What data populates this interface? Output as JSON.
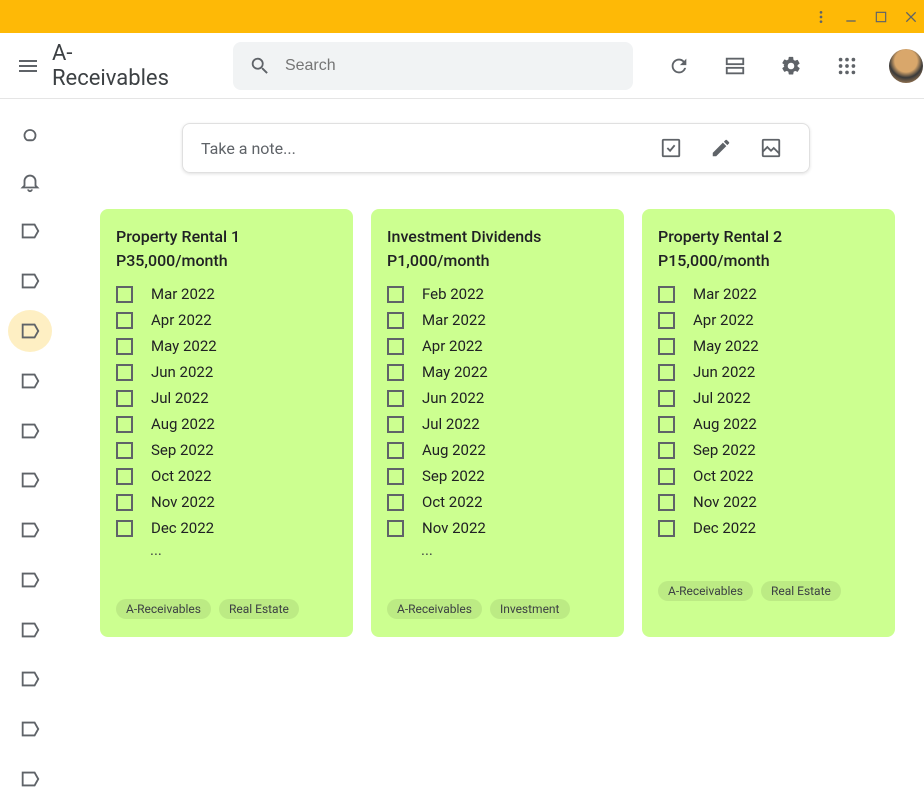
{
  "app": {
    "title": "A-Receivables"
  },
  "search": {
    "placeholder": "Search"
  },
  "take_note": {
    "placeholder": "Take a note..."
  },
  "notes": [
    {
      "title": "Property Rental 1 P35,000/month",
      "items": [
        "Mar 2022",
        "Apr 2022",
        "May 2022",
        "Jun 2022",
        "Jul 2022",
        "Aug 2022",
        "Sep 2022",
        "Oct 2022",
        "Nov 2022",
        "Dec 2022"
      ],
      "more": "...",
      "tags": [
        "A-Receivables",
        "Real Estate"
      ]
    },
    {
      "title": "Investment Dividends P1,000/month",
      "items": [
        "Feb 2022",
        "Mar 2022",
        "Apr 2022",
        "May 2022",
        "Jun 2022",
        "Jul 2022",
        "Aug 2022",
        "Sep 2022",
        "Oct 2022",
        "Nov 2022"
      ],
      "more": "...",
      "tags": [
        "A-Receivables",
        "Investment"
      ]
    },
    {
      "title": "Property Rental 2 P15,000/month",
      "items": [
        "Mar 2022",
        "Apr 2022",
        "May 2022",
        "Jun 2022",
        "Jul 2022",
        "Aug 2022",
        "Sep 2022",
        "Oct 2022",
        "Nov 2022",
        "Dec 2022"
      ],
      "more": "",
      "tags": [
        "A-Receivables",
        "Real Estate"
      ]
    }
  ],
  "sidebar": {
    "items": [
      "notes",
      "reminders",
      "label-1",
      "label-2",
      "label-3",
      "label-4",
      "label-5",
      "label-6",
      "label-7",
      "label-8",
      "label-9",
      "label-10",
      "label-11",
      "label-12"
    ],
    "active_index": 4
  },
  "colors": {
    "note_bg": "#ccff90",
    "titlebar": "#feb906",
    "active_nav": "#feefc3"
  }
}
